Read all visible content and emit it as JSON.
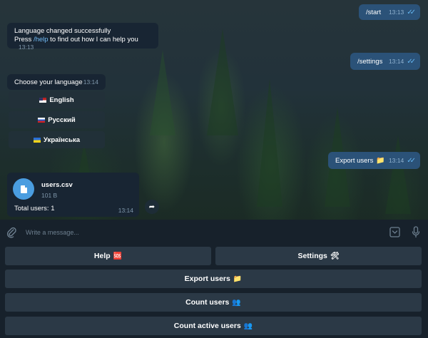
{
  "messages": {
    "start": {
      "text": "/start",
      "time": "13:13"
    },
    "language_changed": {
      "line1": "Language changed successfully",
      "line2_prefix": "Press ",
      "line2_link": "/help",
      "line2_suffix": " to find out how I can help you",
      "time": "13:13"
    },
    "settings": {
      "text": "/settings",
      "time": "13:14"
    },
    "choose_language": {
      "text": "Choose your language",
      "time": "13:14"
    },
    "language_buttons": [
      {
        "label": "English",
        "flag": "us"
      },
      {
        "label": "Русский",
        "flag": "ru"
      },
      {
        "label": "Українська",
        "flag": "ua"
      }
    ],
    "export_users": {
      "text": "Export users",
      "emoji": "📁",
      "time": "13:14"
    },
    "file": {
      "name": "users.csv",
      "size": "101 B",
      "caption": "Total users: 1",
      "time": "13:14"
    }
  },
  "composer": {
    "placeholder": "Write a message..."
  },
  "keyboard": {
    "help": {
      "label": "Help",
      "emoji": "🆘"
    },
    "settings": {
      "label": "Settings",
      "emoji": "🛠"
    },
    "export_users": {
      "label": "Export users",
      "emoji": "📁"
    },
    "count_users": {
      "label": "Count users",
      "emoji": "👥"
    },
    "count_active_users": {
      "label": "Count active users",
      "emoji": "👥"
    }
  },
  "colors": {
    "outgoing_bubble": "#2b5278",
    "incoming_bubble": "#182533",
    "link": "#71baf5",
    "panel": "#17212b",
    "keyboard_button": "#2b3946"
  }
}
